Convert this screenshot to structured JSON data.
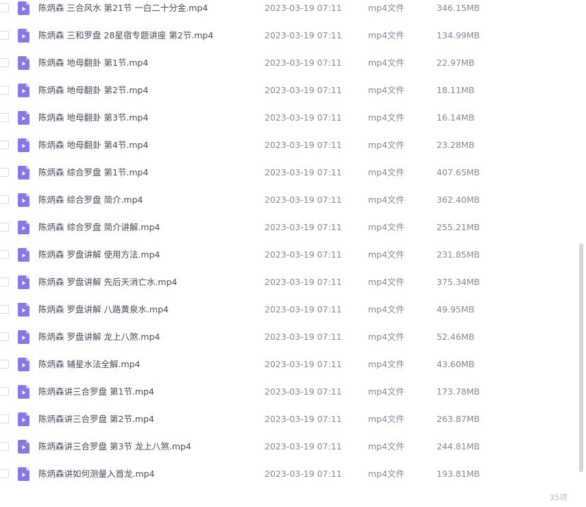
{
  "files": [
    {
      "name": "陈炳森 三合风水 第21节 一白二十分金.mp4",
      "date": "2023-03-19 07:11",
      "type": "mp4文件",
      "size": "346.15MB"
    },
    {
      "name": "陈炳森 三和罗盘 28星宿专题讲座 第2节.mp4",
      "date": "2023-03-19 07:11",
      "type": "mp4文件",
      "size": "134.99MB"
    },
    {
      "name": "陈炳森 地母翻卦 第1节.mp4",
      "date": "2023-03-19 07:11",
      "type": "mp4文件",
      "size": "22.97MB"
    },
    {
      "name": "陈炳森 地母翻卦 第2节.mp4",
      "date": "2023-03-19 07:11",
      "type": "mp4文件",
      "size": "18.11MB"
    },
    {
      "name": "陈炳森 地母翻卦 第3节.mp4",
      "date": "2023-03-19 07:11",
      "type": "mp4文件",
      "size": "16.14MB"
    },
    {
      "name": "陈炳森 地母翻卦 第4节.mp4",
      "date": "2023-03-19 07:11",
      "type": "mp4文件",
      "size": "23.28MB"
    },
    {
      "name": "陈炳森 综合罗盘 第1节.mp4",
      "date": "2023-03-19 07:11",
      "type": "mp4文件",
      "size": "407.65MB"
    },
    {
      "name": "陈炳森 综合罗盘 简介.mp4",
      "date": "2023-03-19 07:11",
      "type": "mp4文件",
      "size": "362.40MB"
    },
    {
      "name": "陈炳森 综合罗盘 简介讲解.mp4",
      "date": "2023-03-19 07:11",
      "type": "mp4文件",
      "size": "255.21MB"
    },
    {
      "name": "陈炳森 罗盘讲解 使用方法.mp4",
      "date": "2023-03-19 07:11",
      "type": "mp4文件",
      "size": "231.85MB"
    },
    {
      "name": "陈炳森 罗盘讲解 先后天消亡水.mp4",
      "date": "2023-03-19 07:11",
      "type": "mp4文件",
      "size": "375.34MB"
    },
    {
      "name": "陈炳森 罗盘讲解 八路黄泉水.mp4",
      "date": "2023-03-19 07:11",
      "type": "mp4文件",
      "size": "49.95MB"
    },
    {
      "name": "陈炳森 罗盘讲解 龙上八煞.mp4",
      "date": "2023-03-19 07:11",
      "type": "mp4文件",
      "size": "52.46MB"
    },
    {
      "name": "陈炳森 辅星水法全解.mp4",
      "date": "2023-03-19 07:11",
      "type": "mp4文件",
      "size": "43.60MB"
    },
    {
      "name": "陈炳森讲三合罗盘 第1节.mp4",
      "date": "2023-03-19 07:11",
      "type": "mp4文件",
      "size": "173.78MB"
    },
    {
      "name": "陈炳森讲三合罗盘 第2节.mp4",
      "date": "2023-03-19 07:11",
      "type": "mp4文件",
      "size": "263.87MB"
    },
    {
      "name": "陈炳森讲三合罗盘 第3节 龙上八煞.mp4",
      "date": "2023-03-19 07:11",
      "type": "mp4文件",
      "size": "244.81MB"
    },
    {
      "name": "陈炳森讲如何测量入首龙.mp4",
      "date": "2023-03-19 07:11",
      "type": "mp4文件",
      "size": "193.81MB"
    }
  ],
  "footer": {
    "count": "35项"
  },
  "scroll": {
    "thumb_start_fraction": 0.5,
    "thumb_size_fraction": 0.47
  },
  "colors": {
    "file_icon": "#8b76e8",
    "file_icon_fold": "#c4b8f3"
  },
  "icons": {
    "file": "video-file-icon",
    "checkbox": "checkbox-icon"
  }
}
